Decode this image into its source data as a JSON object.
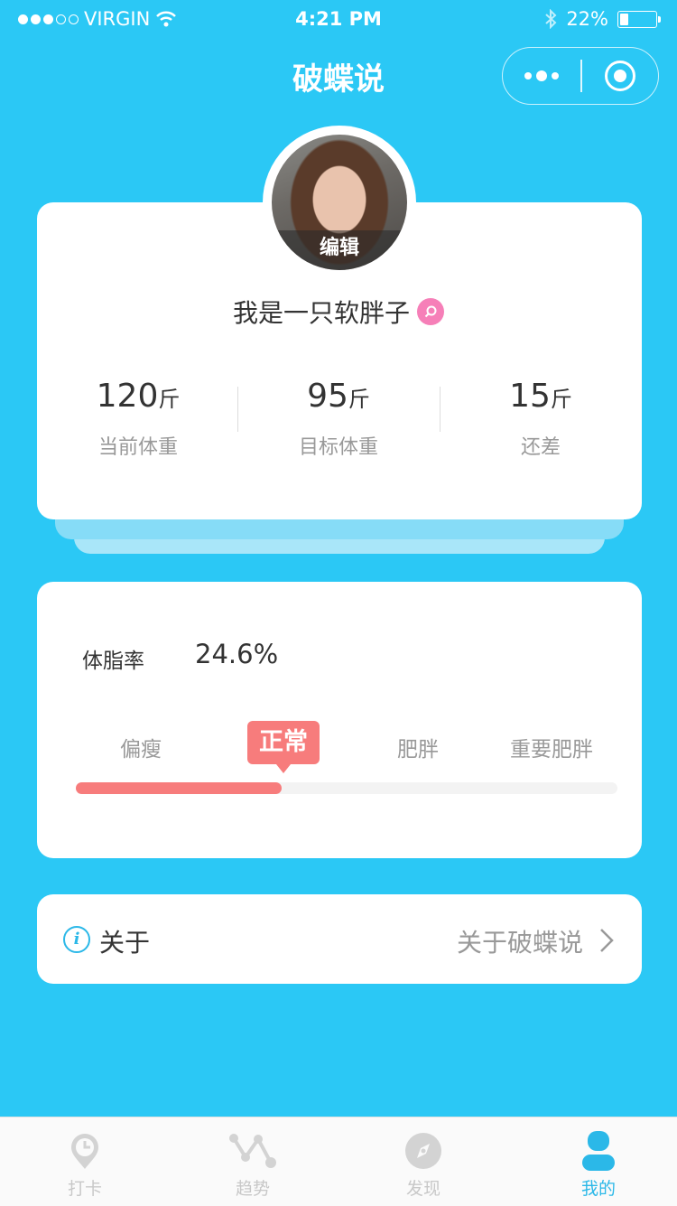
{
  "status_bar": {
    "carrier": "VIRGIN",
    "time": "4:21 PM",
    "battery": "22%",
    "battery_level": 0.22
  },
  "nav": {
    "title": "破蝶说"
  },
  "profile": {
    "edit_label": "编辑",
    "username": "我是一只软胖子",
    "stats": [
      {
        "value": "120",
        "unit": "斤",
        "label": "当前体重"
      },
      {
        "value": "95",
        "unit": "斤",
        "label": "目标体重"
      },
      {
        "value": "15",
        "unit": "斤",
        "label": "还差"
      }
    ]
  },
  "body_fat": {
    "label": "体脂率",
    "value": "24.6%",
    "ranges": [
      "偏瘦",
      "正常",
      "肥胖",
      "重要肥胖"
    ],
    "active_range": "正常",
    "progress": 0.38,
    "accent_color": "#f77c7c"
  },
  "about": {
    "title": "关于",
    "link": "关于破蝶说"
  },
  "tabs": [
    {
      "label": "打卡",
      "icon": "clock-pin-icon",
      "active": false
    },
    {
      "label": "趋势",
      "icon": "trend-icon",
      "active": false
    },
    {
      "label": "发现",
      "icon": "compass-icon",
      "active": false
    },
    {
      "label": "我的",
      "icon": "person-icon",
      "active": true
    }
  ],
  "colors": {
    "background": "#2bc8f5",
    "tab_active": "#2bb8e8",
    "tab_inactive": "#c8c8c8"
  }
}
